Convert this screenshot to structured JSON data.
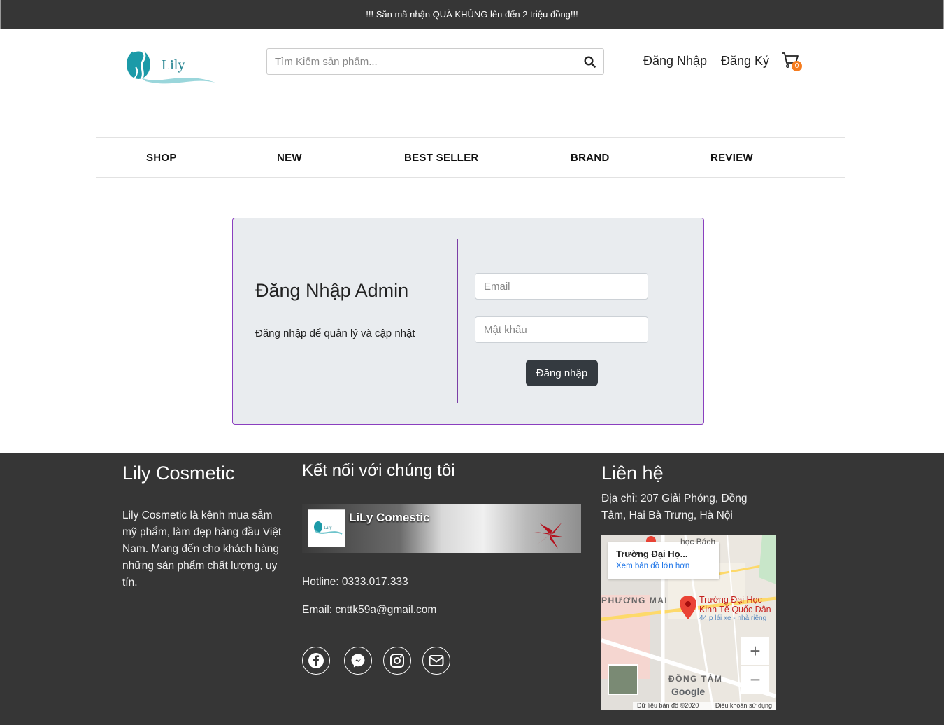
{
  "topbar": {
    "promo": "!!! Săn mã nhận QUÀ KHỦNG lên đến 2 triệu đồng!!!"
  },
  "header": {
    "logo_text": "Lily",
    "search_placeholder": "Tìm Kiếm sản phẩm...",
    "login_link": "Đăng Nhập",
    "register_link": "Đăng Ký",
    "cart_count": "0"
  },
  "nav": {
    "items": [
      "SHOP",
      "NEW",
      "BEST SELLER",
      "BRAND",
      "REVIEW"
    ]
  },
  "login": {
    "title": "Đăng Nhập Admin",
    "subtitle": "Đăng nhập để quản lý và cập nhật",
    "email_placeholder": "Email",
    "password_placeholder": "Mật khẩu",
    "submit_label": "Đăng nhập"
  },
  "footer": {
    "brand_title": "Lily Cosmetic",
    "brand_desc": "Lily Cosmetic là kênh mua sắm mỹ phẩm, làm đẹp hàng đầu Việt Nam. Mang đến cho khách hàng những sản phẩm chất lượng, uy tín.",
    "connect_title": "Kết nối với chúng tôi",
    "fb_page_name": "LiLy Comestic",
    "hotline": "Hotline: 0333.017.333",
    "email": "Email: cnttk59a@gmail.com",
    "contact_title": "Liên hệ",
    "address": "Địa chỉ: 207 Giải Phóng, Đồng Tâm, Hai Bà Trưng, Hà Nội",
    "map": {
      "card_title": "Trường Đại Họ...",
      "card_link": "Xem bản đồ lớn hơn",
      "place_line1": "Trường Đại Học",
      "place_line2": "Kinh Tế Quốc Dân",
      "place_small": "44 p lái xe - nhà riêng",
      "top_text": "học Bách",
      "district1": "PHƯƠNG MAI",
      "district2": "ĐỒNG TÂM",
      "zoom_in": "+",
      "zoom_out": "−",
      "google": "Google",
      "data_credit": "Dữ liệu bản đồ ©2020",
      "terms": "Điều khoản sử dụng"
    }
  },
  "colors": {
    "topbar_bg": "#363636",
    "footer_bg": "#363636",
    "card_bg": "#e9ecef",
    "card_border": "#8a3fbf",
    "cart_badge": "#f57c1f",
    "button_bg": "#343a40"
  }
}
